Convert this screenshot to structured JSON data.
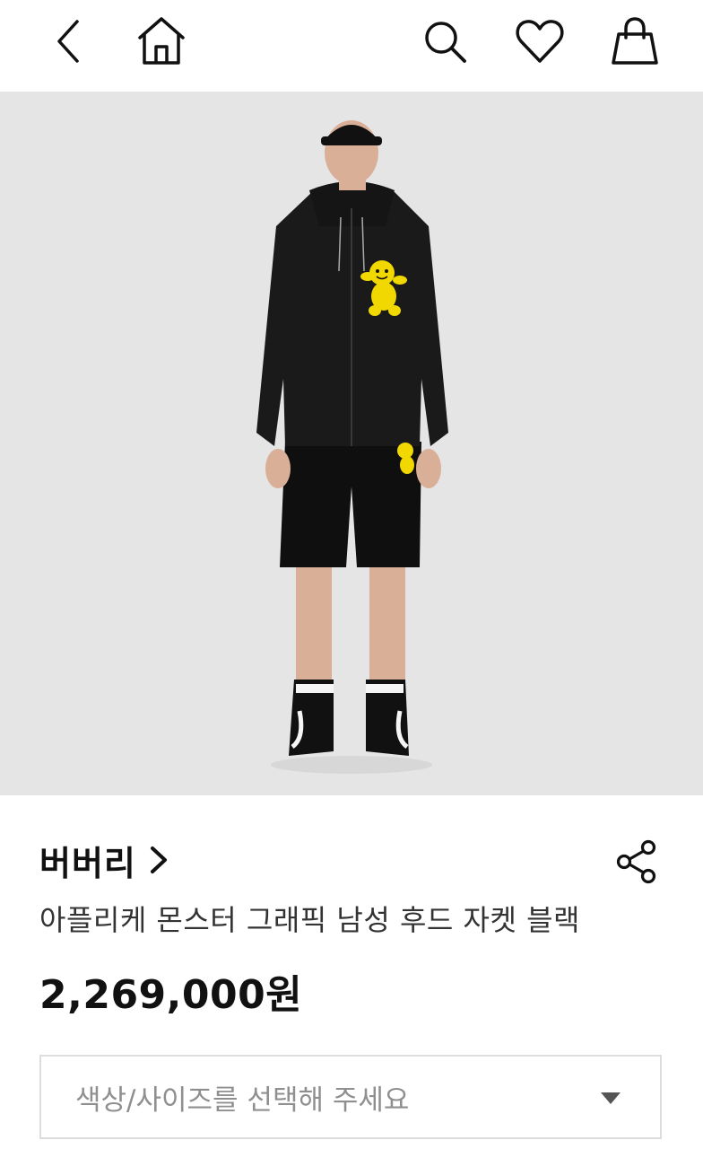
{
  "header": {
    "back_icon": "chevron-left-icon",
    "home_icon": "home-icon",
    "search_icon": "search-icon",
    "wishlist_icon": "heart-icon",
    "cart_icon": "shopping-bag-icon"
  },
  "product": {
    "brand": "버버리",
    "name": "아플리케 몬스터 그래픽 남성 후드 자켓 블랙",
    "price": "2,269,000원",
    "image_background": "#e5e5e5",
    "accent_yellow": "#f0d800"
  },
  "option_select": {
    "placeholder": "색상/사이즈를 선택해 주세요"
  }
}
